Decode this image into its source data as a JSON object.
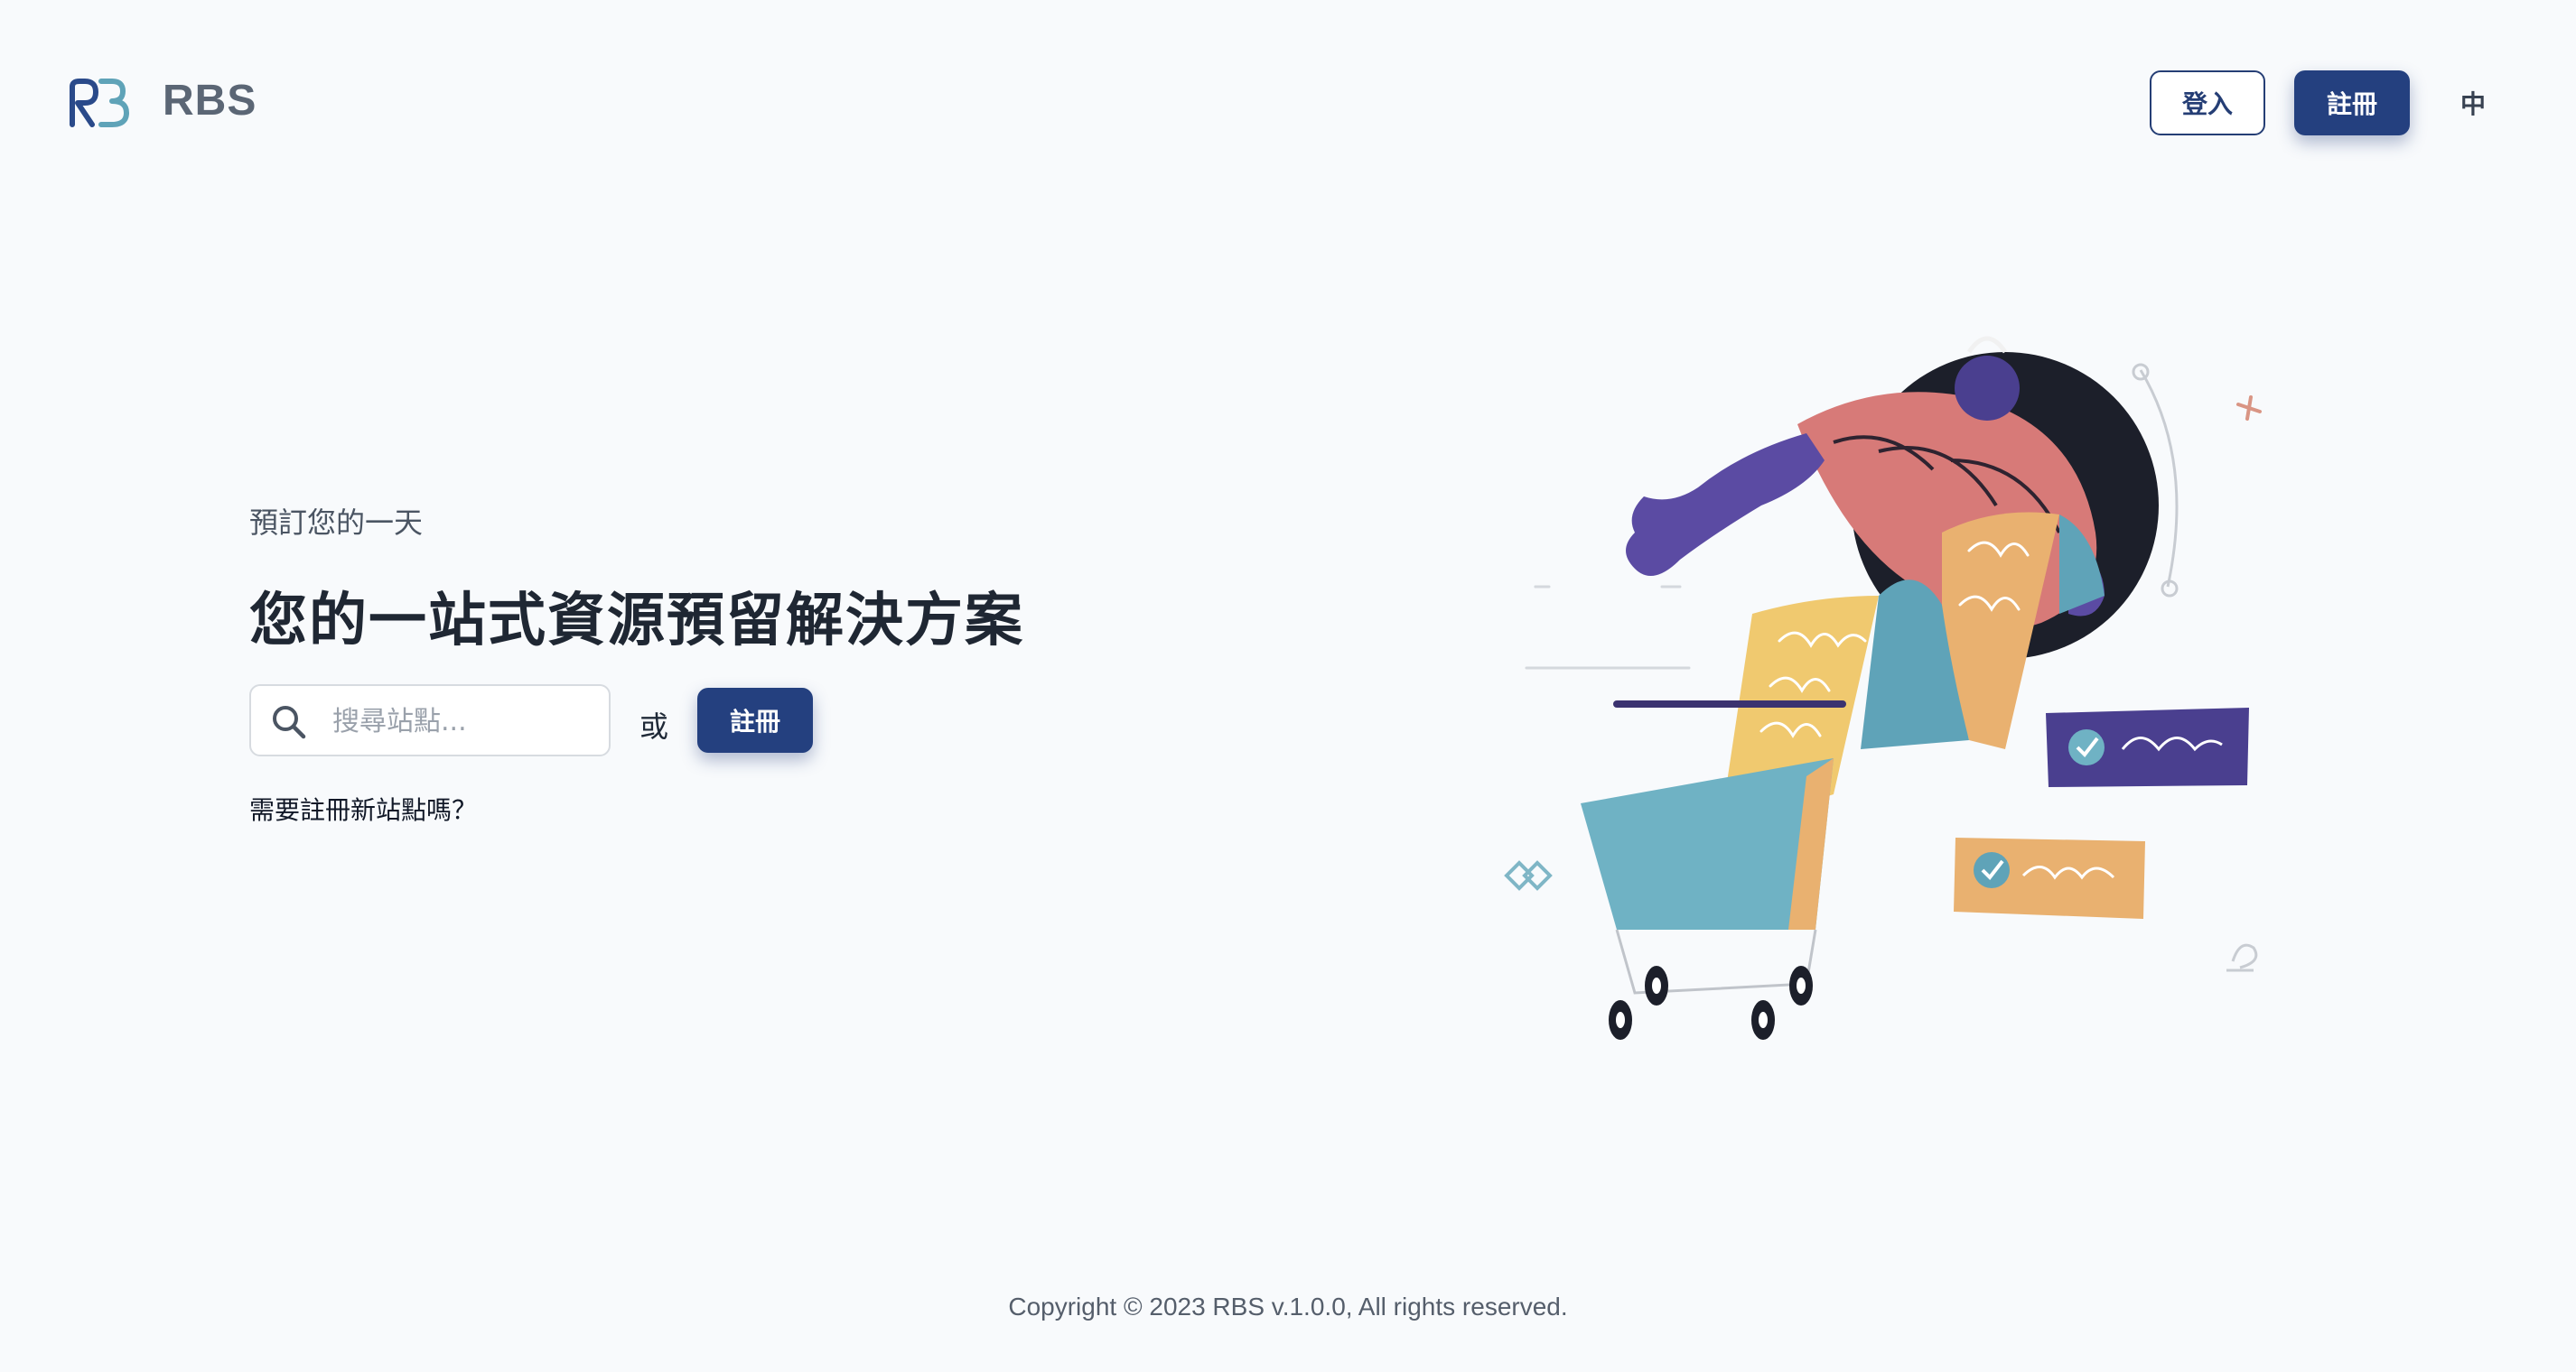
{
  "header": {
    "brand": "RBS",
    "login_label": "登入",
    "register_label": "註冊",
    "language_label": "中"
  },
  "hero": {
    "eyebrow": "預訂您的一天",
    "headline": "您的一站式資源預留解決方案",
    "search_placeholder": "搜尋站點...",
    "or_text": "或",
    "register_label": "註冊",
    "need_register_text": "需要註冊新站點嗎？"
  },
  "footer": {
    "copyright": "Copyright © 2023 RBS v.1.0.0, All rights reserved."
  },
  "icons": {
    "logo": "rb-logo-icon",
    "search": "search-icon",
    "illustration": "shopping-cart-illustration"
  },
  "colors": {
    "primary": "#24407f",
    "background": "#f8fafc",
    "logo_dark": "#2a4a8a",
    "logo_light": "#5fa3b8"
  }
}
